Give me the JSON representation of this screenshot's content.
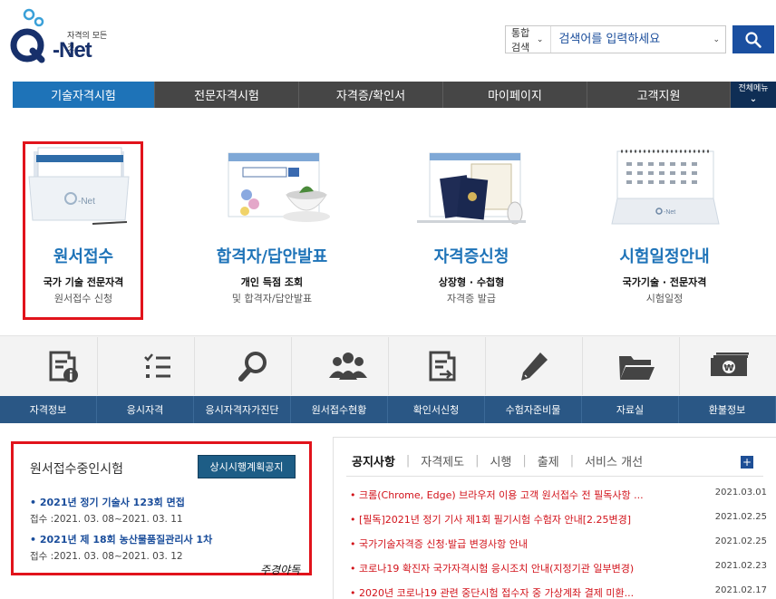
{
  "header": {
    "logo_tagline": "자격의 모든것",
    "logo_text": "-Net",
    "search_scope": "통합검색",
    "search_placeholder": "검색어를 입력하세요",
    "colors": {
      "brand": "#17306b",
      "accent": "#1e73b8",
      "search_button": "#1a4fa0"
    }
  },
  "nav": {
    "items": [
      {
        "label": "기술자격시험",
        "active": true
      },
      {
        "label": "전문자격시험",
        "active": false
      },
      {
        "label": "자격증/확인서",
        "active": false
      },
      {
        "label": "마이페이지",
        "active": false
      },
      {
        "label": "고객지원",
        "active": false
      }
    ],
    "all_menu_label": "전체메뉴"
  },
  "features": [
    {
      "title": "원서접수",
      "sub": "국가 기술 전문자격",
      "sub2": "원서접수 신청",
      "icon": "folder-icon"
    },
    {
      "title": "합격자/답안발표",
      "sub": "개인 득점 조회",
      "sub2": "및 합격자/답안발표",
      "icon": "browser-icon"
    },
    {
      "title": "자격증신청",
      "sub": "상장형 · 수첩형",
      "sub2": "자격증 발급",
      "icon": "passport-icon"
    },
    {
      "title": "시험일정안내",
      "sub": "국가기술 · 전문자격",
      "sub2": "시험일정",
      "icon": "calendar-icon"
    }
  ],
  "quick_menu": [
    {
      "label": "자격정보",
      "icon": "document-info-icon"
    },
    {
      "label": "응시자격",
      "icon": "checklist-icon"
    },
    {
      "label": "응시자격자가진단",
      "icon": "magnifier-icon"
    },
    {
      "label": "원서접수현황",
      "icon": "people-icon"
    },
    {
      "label": "확인서신청",
      "icon": "document-edit-icon"
    },
    {
      "label": "수험자준비물",
      "icon": "pencil-icon"
    },
    {
      "label": "자료실",
      "icon": "folder-open-icon"
    },
    {
      "label": "환불정보",
      "icon": "money-icon"
    }
  ],
  "ongoing": {
    "title": "원서접수중인시험",
    "button": "상시시행계획공지",
    "items": [
      {
        "name": "• 2021년 정기 기술사 123회 면접",
        "date": "접수 :2021. 03. 08~2021. 03. 11"
      },
      {
        "name": "• 2021년 제 18회 농산물품질관리사 1차",
        "date": "접수 :2021. 03. 08~2021. 03. 12"
      }
    ],
    "signature": "주경야독"
  },
  "board": {
    "tabs": [
      {
        "label": "공지사항",
        "active": true
      },
      {
        "label": "자격제도",
        "active": false
      },
      {
        "label": "시행",
        "active": false
      },
      {
        "label": "출제",
        "active": false
      },
      {
        "label": "서비스 개선",
        "active": false
      }
    ],
    "plus": "+",
    "notices": [
      {
        "title": "• 크롬(Chrome, Edge) 브라우저 이용 고객 원서접수 전 필독사항 ...",
        "date": "2021.03.01"
      },
      {
        "title": "• [필독]2021년 정기 기사 제1회 필기시험 수험자 안내[2.25변경]",
        "date": "2021.02.25"
      },
      {
        "title": "• 국가기술자격증 신청·발급 변경사항 안내",
        "date": "2021.02.25"
      },
      {
        "title": "• 코로나19 확진자 국가자격시험 응시조치 안내(지정기관 일부변경)",
        "date": "2021.02.23"
      },
      {
        "title": "• 2020년 코로나19 관련 중단시험 접수자 중 가상계좌 결제 미환...",
        "date": "2021.02.17"
      }
    ]
  }
}
